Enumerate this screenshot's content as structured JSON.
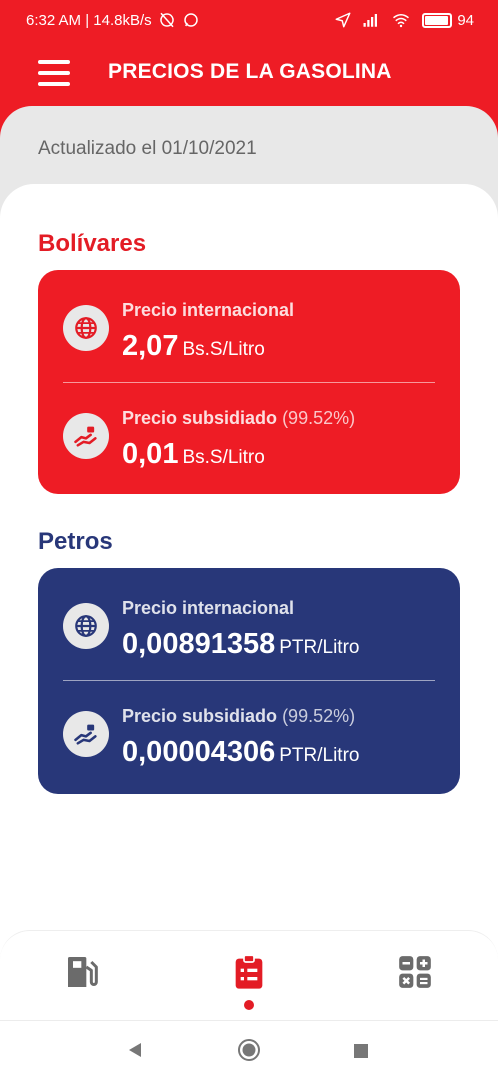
{
  "status_bar": {
    "time_speed": "6:32 AM | 14.8kB/s",
    "battery": "94",
    "battery_level_percent": 94,
    "icons": [
      "alarm-off-icon",
      "whatsapp-icon",
      "location-arrow-icon",
      "signal-icon",
      "wifi-icon",
      "battery-icon"
    ]
  },
  "app_bar": {
    "title": "PRECIOS DE LA GASOLINA",
    "menu_icon": "hamburger-menu-icon"
  },
  "updated": {
    "text": "Actualizado el 01/10/2021"
  },
  "sections": [
    {
      "title": "Bolívares",
      "color": "#ee1c25",
      "rows": [
        {
          "icon": "globe-icon",
          "label": "Precio internacional",
          "pct": "",
          "value": "2,07",
          "unit": "Bs.S/Litro"
        },
        {
          "icon": "hand-money-icon",
          "label": "Precio subsidiado",
          "pct": "(99.52%)",
          "value": "0,01",
          "unit": "Bs.S/Litro"
        }
      ]
    },
    {
      "title": "Petros",
      "color": "#283779",
      "rows": [
        {
          "icon": "globe-icon",
          "label": "Precio internacional",
          "pct": "",
          "value": "0,00891358",
          "unit": "PTR/Litro"
        },
        {
          "icon": "hand-money-icon",
          "label": "Precio subsidiado",
          "pct": "(99.52%)",
          "value": "0,00004306",
          "unit": "PTR/Litro"
        }
      ]
    }
  ],
  "bottom_nav": {
    "items": [
      {
        "icon": "fuel-pump-icon",
        "active": false
      },
      {
        "icon": "clipboard-list-icon",
        "active": true
      },
      {
        "icon": "calculator-icon",
        "active": false
      }
    ],
    "active_color": "#e31c25",
    "inactive_color": "#6b6b6b"
  },
  "system_nav": {
    "icons": [
      "back-icon",
      "home-icon",
      "recents-icon"
    ]
  }
}
